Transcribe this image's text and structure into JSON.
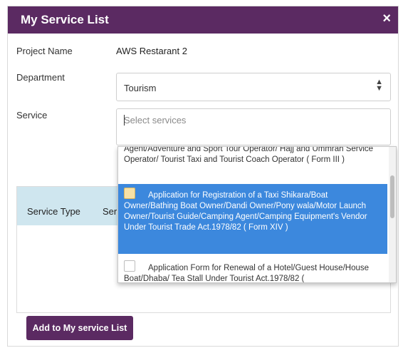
{
  "modal": {
    "title": "My Service List",
    "close_glyph": "×"
  },
  "form": {
    "project_label": "Project Name",
    "project_value": "AWS Restarant 2",
    "department_label": "Department",
    "department_value": "Tourism",
    "service_label": "Service",
    "service_placeholder": "Select services"
  },
  "dropdown": {
    "options": [
      {
        "label": "Agent/Adventure and Sport Tour Operator/ Hajj and Ummrah Service Operator/ Tourist Taxi and Tourist Coach Operator ( Form III )",
        "selected": false
      },
      {
        "label": "Application for Registration of a Taxi Shikara/Boat Owner/Bathing Boat Owner/Dandi Owner/Pony wala/Motor Launch Owner/Tourist Guide/Camping Agent/Camping Equipment's Vendor Under Tourist Trade Act.1978/82 ( Form XIV )",
        "selected": true
      },
      {
        "label": "Application Form for Renewal of a Hotel/Guest House/House Boat/Dhaba/ Tea Stall Under Tourist Act.1978/82 (",
        "selected": false
      }
    ]
  },
  "table": {
    "headers": [
      "Service Type",
      "Ser"
    ]
  },
  "actions": {
    "add_label": "Add to My service List"
  },
  "colors": {
    "header_bg": "#5b2a62",
    "selected_option_bg": "#3c88dd",
    "table_head_bg": "#cfe6ef"
  }
}
